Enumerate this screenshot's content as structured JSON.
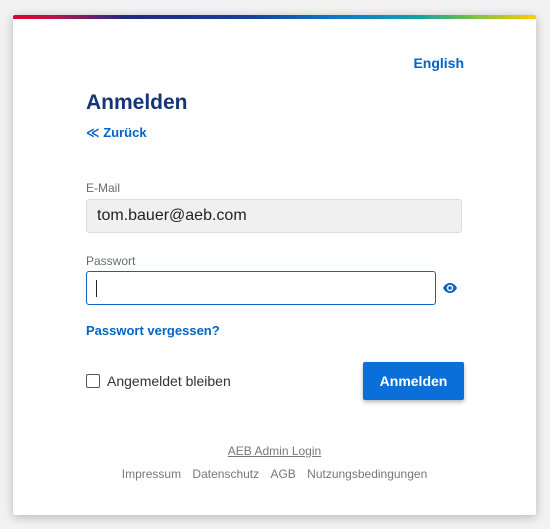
{
  "header": {
    "language_link": "English"
  },
  "login": {
    "title": "Anmelden",
    "back_link": "≪ Zurück",
    "email_label": "E-Mail",
    "email_value": "tom.bauer@aeb.com",
    "password_label": "Passwort",
    "password_value": "",
    "forgot_link": "Passwort vergessen?",
    "remember_label": "Angemeldet bleiben",
    "remember_checked": false,
    "submit_label": "Anmelden"
  },
  "footer": {
    "admin_link": "AEB Admin Login",
    "links": [
      "Impressum",
      "Datenschutz",
      "AGB",
      "Nutzungsbedingungen"
    ]
  },
  "colors": {
    "title": "#13357a",
    "link": "#0064c8",
    "primary_button": "#0a6fd8",
    "input_focus_border": "#0b63c4"
  },
  "icons": {
    "password_toggle": "eye-icon"
  }
}
